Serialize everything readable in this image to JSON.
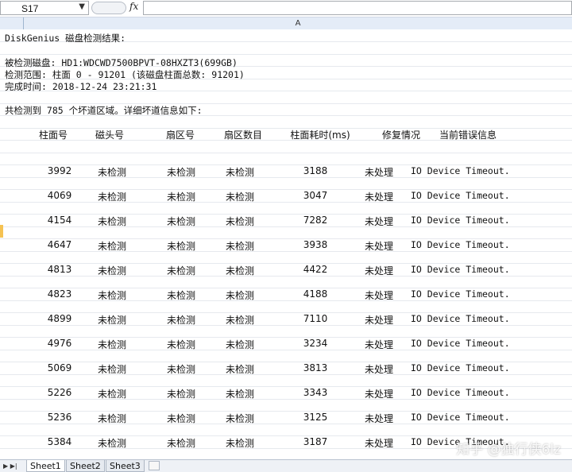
{
  "formula_bar": {
    "cell_ref": "S17",
    "fx": "fx"
  },
  "column_header": "A",
  "report": {
    "title": "DiskGenius 磁盘检测结果:",
    "disk": "被检测磁盘: HD1:WDCWD7500BPVT-08HXZT3(699GB)",
    "range": "检测范围: 柱面 0 - 91201 (该磁盘柱面总数: 91201)",
    "finish_time": "完成时间: 2018-12-24 23:21:31",
    "summary": "共检测到 785 个坏道区域。详细坏道信息如下:"
  },
  "table": {
    "headers": [
      "柱面号",
      "磁头号",
      "扇区号",
      "扇区数目",
      "柱面耗时(ms)",
      "修复情况",
      "当前错误信息"
    ],
    "rows": [
      [
        "3992",
        "未检测",
        "未检测",
        "未检测",
        "3188",
        "未处理",
        "IO Device Timeout."
      ],
      [
        "4069",
        "未检测",
        "未检测",
        "未检测",
        "3047",
        "未处理",
        "IO Device Timeout."
      ],
      [
        "4154",
        "未检测",
        "未检测",
        "未检测",
        "7282",
        "未处理",
        "IO Device Timeout."
      ],
      [
        "4647",
        "未检测",
        "未检测",
        "未检测",
        "3938",
        "未处理",
        "IO Device Timeout."
      ],
      [
        "4813",
        "未检测",
        "未检测",
        "未检测",
        "4422",
        "未处理",
        "IO Device Timeout."
      ],
      [
        "4823",
        "未检测",
        "未检测",
        "未检测",
        "4188",
        "未处理",
        "IO Device Timeout."
      ],
      [
        "4899",
        "未检测",
        "未检测",
        "未检测",
        "7110",
        "未处理",
        "IO Device Timeout."
      ],
      [
        "4976",
        "未检测",
        "未检测",
        "未检测",
        "3234",
        "未处理",
        "IO Device Timeout."
      ],
      [
        "5069",
        "未检测",
        "未检测",
        "未检测",
        "3813",
        "未处理",
        "IO Device Timeout."
      ],
      [
        "5226",
        "未检测",
        "未检测",
        "未检测",
        "3343",
        "未处理",
        "IO Device Timeout."
      ],
      [
        "5236",
        "未检测",
        "未检测",
        "未检测",
        "3125",
        "未处理",
        "IO Device Timeout."
      ],
      [
        "5384",
        "未检测",
        "未检测",
        "未检测",
        "3187",
        "未处理",
        "IO Device Timeout."
      ]
    ]
  },
  "watermark": "知乎 @独行侠6lz",
  "tabs": {
    "nav": "▶ ▶|",
    "items": [
      "Sheet1",
      "Sheet2",
      "Sheet3"
    ]
  }
}
